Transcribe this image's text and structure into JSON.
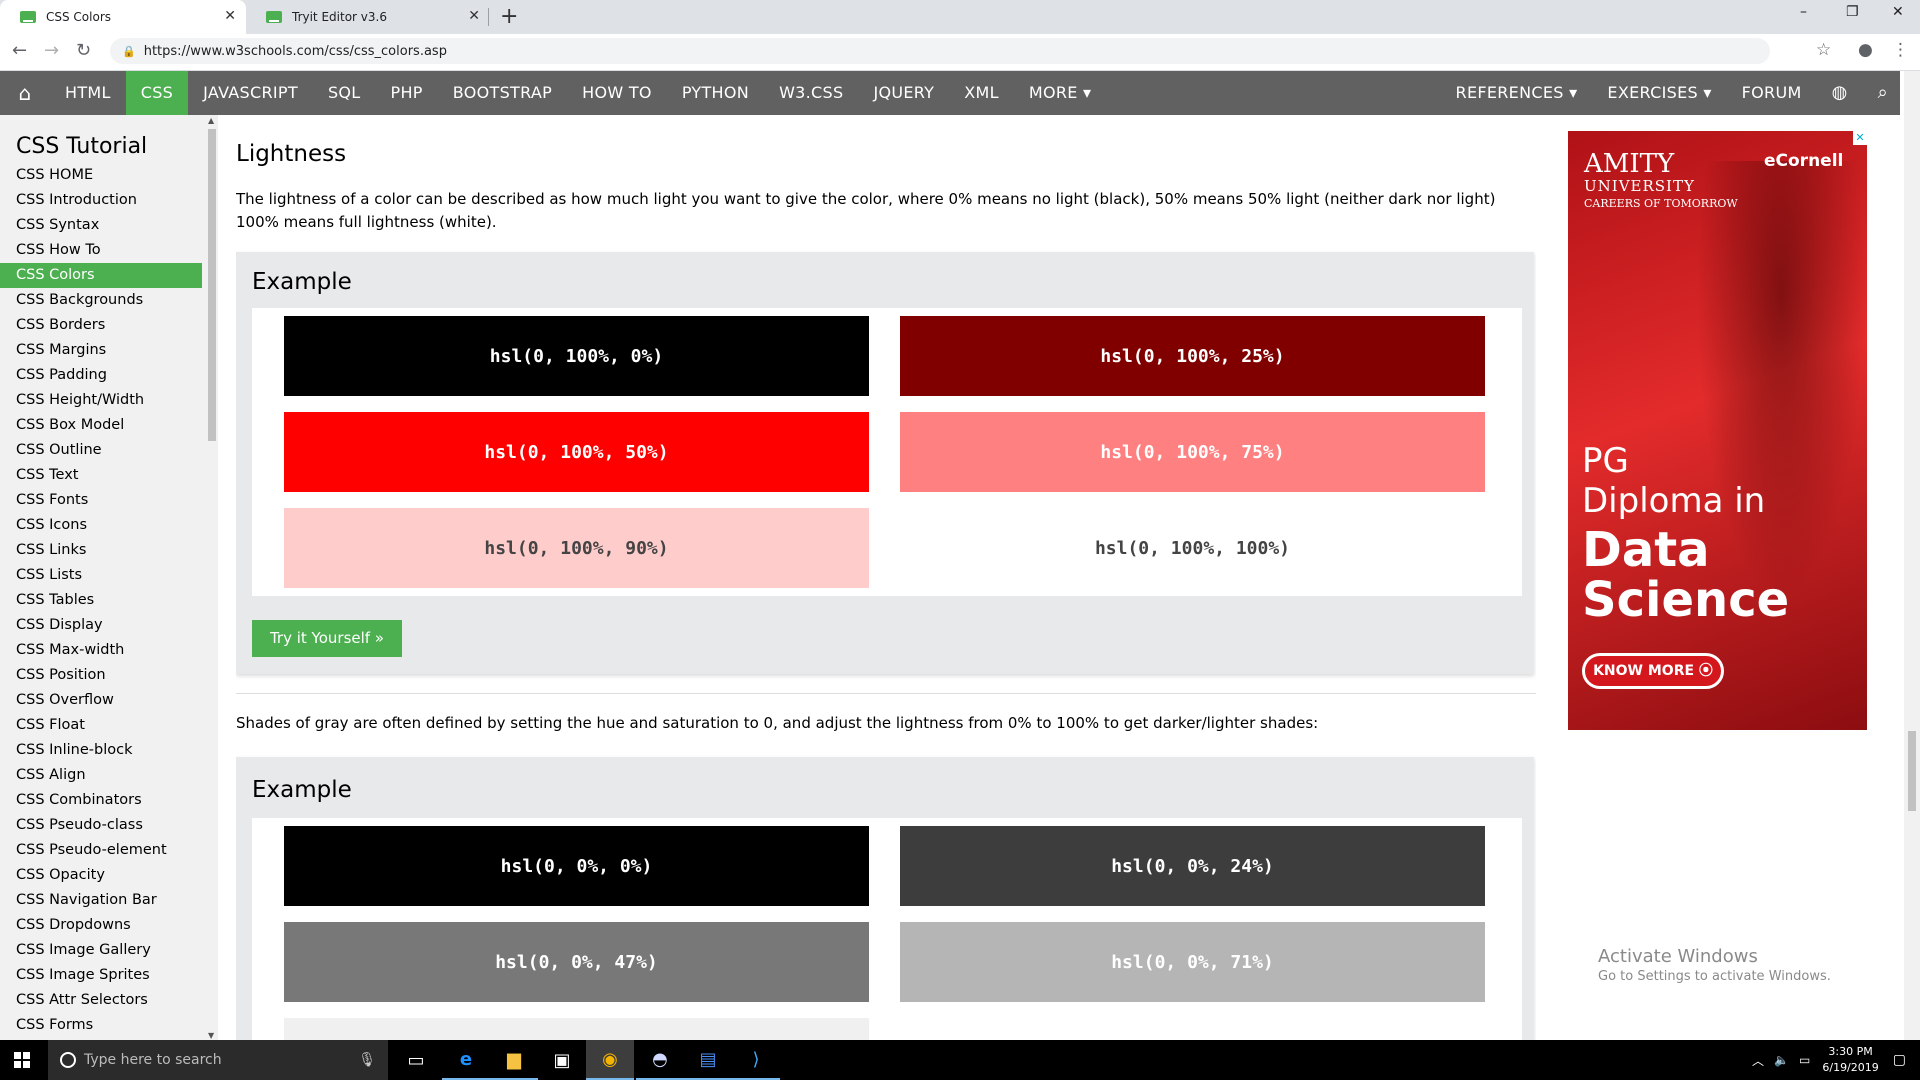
{
  "browser": {
    "tabs": [
      {
        "title": "CSS Colors",
        "active": true
      },
      {
        "title": "Tryit Editor v3.6",
        "active": false
      }
    ],
    "url": "https://www.w3schools.com/css/css_colors.asp",
    "window_controls": {
      "minimize": "–",
      "restore": "❐",
      "close": "✕"
    }
  },
  "topnav": {
    "items": [
      "HTML",
      "CSS",
      "JAVASCRIPT",
      "SQL",
      "PHP",
      "BOOTSTRAP",
      "HOW TO",
      "PYTHON",
      "W3.CSS",
      "JQUERY",
      "XML",
      "MORE ▾"
    ],
    "right": [
      "REFERENCES ▾",
      "EXERCISES ▾",
      "FORUM"
    ],
    "active": "CSS",
    "accent": "#4caf50",
    "bar_color": "#616161"
  },
  "sidebar": {
    "title": "CSS Tutorial",
    "items": [
      "CSS HOME",
      "CSS Introduction",
      "CSS Syntax",
      "CSS How To",
      "CSS Colors",
      "CSS Backgrounds",
      "CSS Borders",
      "CSS Margins",
      "CSS Padding",
      "CSS Height/Width",
      "CSS Box Model",
      "CSS Outline",
      "CSS Text",
      "CSS Fonts",
      "CSS Icons",
      "CSS Links",
      "CSS Lists",
      "CSS Tables",
      "CSS Display",
      "CSS Max-width",
      "CSS Position",
      "CSS Overflow",
      "CSS Float",
      "CSS Inline-block",
      "CSS Align",
      "CSS Combinators",
      "CSS Pseudo-class",
      "CSS Pseudo-element",
      "CSS Opacity",
      "CSS Navigation Bar",
      "CSS Dropdowns",
      "CSS Image Gallery",
      "CSS Image Sprites",
      "CSS Attr Selectors",
      "CSS Forms"
    ],
    "active": "CSS Colors"
  },
  "main": {
    "heading": "Lightness",
    "description": "The lightness of a color can be described as how much light you want to give the color, where 0% means no light (black), 50% means 50% light (neither dark nor light) 100% means full lightness (white).",
    "example1": {
      "title": "Example",
      "swatches": [
        {
          "label": "hsl(0, 100%, 0%)",
          "bg": "#000000",
          "fg": "#ffffff"
        },
        {
          "label": "hsl(0, 100%, 25%)",
          "bg": "#800000",
          "fg": "#ffffff"
        },
        {
          "label": "hsl(0, 100%, 50%)",
          "bg": "#ff0000",
          "fg": "#ffffff"
        },
        {
          "label": "hsl(0, 100%, 75%)",
          "bg": "#ff8080",
          "fg": "#ffffff"
        },
        {
          "label": "hsl(0, 100%, 90%)",
          "bg": "#ffcccc",
          "fg": "#444444"
        },
        {
          "label": "hsl(0, 100%, 100%)",
          "bg": "#ffffff",
          "fg": "#444444"
        }
      ],
      "button": "Try it Yourself »"
    },
    "gray_description": "Shades of gray are often defined by setting the hue and saturation to 0, and adjust the lightness from 0% to 100% to get darker/lighter shades:",
    "example2": {
      "title": "Example",
      "swatches": [
        {
          "label": "hsl(0, 0%, 0%)",
          "bg": "#000000",
          "fg": "#ffffff"
        },
        {
          "label": "hsl(0, 0%, 24%)",
          "bg": "#3d3d3d",
          "fg": "#ffffff"
        },
        {
          "label": "hsl(0, 0%, 47%)",
          "bg": "#787878",
          "fg": "#ffffff"
        },
        {
          "label": "hsl(0, 0%, 71%)",
          "bg": "#b5b5b5",
          "fg": "#ffffff"
        },
        {
          "label": "",
          "bg": "#f0f0f0",
          "fg": "#444444"
        }
      ]
    }
  },
  "ad": {
    "brand1": "AMITY",
    "brand1_sub": "UNIVERSITY",
    "brand1_tag": "CAREERS OF TOMORROW",
    "brand2": "eCornell",
    "headline1": "PG",
    "headline2": "Diploma in",
    "headline3": "Data",
    "headline4": "Science",
    "cta": "KNOW MORE ⦿",
    "close": "✕"
  },
  "watermark": {
    "line1": "Activate Windows",
    "line2": "Go to Settings to activate Windows."
  },
  "taskbar": {
    "search_placeholder": "Type here to search",
    "time": "3:30 PM",
    "date": "6/19/2019"
  }
}
